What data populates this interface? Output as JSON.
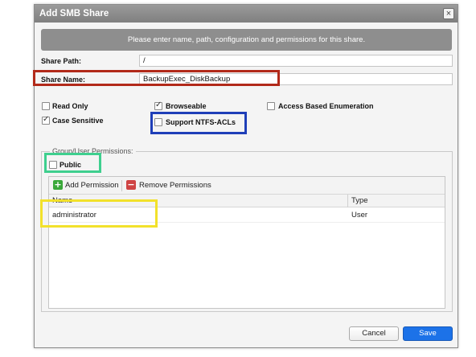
{
  "dialog": {
    "title": "Add SMB Share",
    "close_glyph": "×",
    "instruction": "Please enter name, path, configuration and permissions for this share."
  },
  "form": {
    "share_path_label": "Share Path:",
    "share_path_value": "/",
    "share_name_label": "Share Name:",
    "share_name_value": "BackupExec_DiskBackup"
  },
  "options": {
    "read_only": {
      "label": "Read Only",
      "checked": false
    },
    "browseable": {
      "label": "Browseable",
      "checked": true
    },
    "access_based_enumeration": {
      "label": "Access Based Enumeration",
      "checked": false
    },
    "case_sensitive": {
      "label": "Case Sensitive",
      "checked": true
    },
    "support_ntfs_acls": {
      "label": "Support NTFS-ACLs",
      "checked": false
    }
  },
  "permissions": {
    "legend": "Group/User Permissions:",
    "public": {
      "label": "Public",
      "checked": false
    },
    "toolbar": {
      "add_label": "Add Permission",
      "add_glyph": "+",
      "remove_label": "Remove Permissions",
      "remove_glyph": "−"
    },
    "columns": {
      "name": "Name",
      "type": "Type"
    },
    "rows": [
      {
        "name": "administrator",
        "type": "User"
      }
    ]
  },
  "footer": {
    "cancel_label": "Cancel",
    "save_label": "Save"
  },
  "colors": {
    "title_bar": "#8a8a8a",
    "save_button": "#1c72e8",
    "highlight_red": "#b22a1a",
    "highlight_blue": "#1f3fb8",
    "highlight_green": "#3ecf8e",
    "highlight_yellow": "#f2e12b",
    "add_icon": "#3aa83a",
    "remove_icon": "#cf4343"
  },
  "icons": [
    "close-icon",
    "add-icon",
    "remove-icon",
    "checkbox"
  ]
}
